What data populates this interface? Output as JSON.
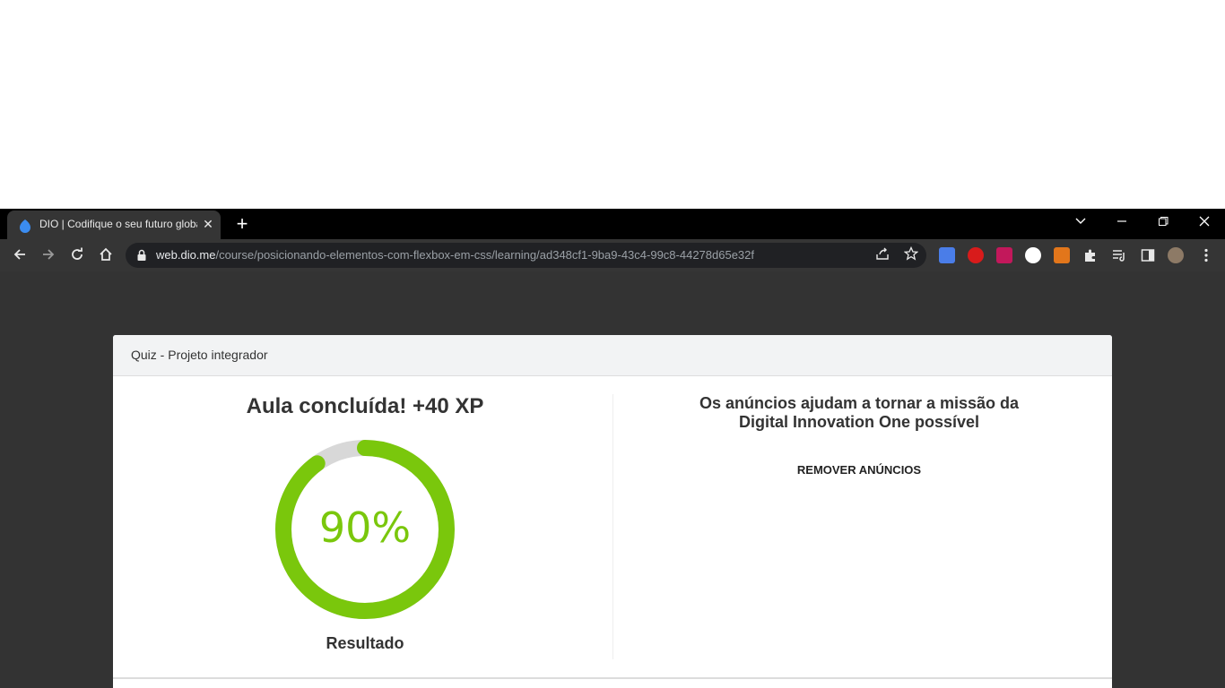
{
  "browser": {
    "tab_title": "DIO | Codifique o seu futuro global",
    "tab_close": "✕",
    "new_tab": "+",
    "url_host": "web.dio.me",
    "url_path": "/course/posicionando-elementos-com-flexbox-em-css/learning/ad348cf1-9ba9-43c4-99c8-44278d65e32f"
  },
  "card": {
    "header_title": "Quiz - Projeto integrador",
    "lesson_title": "Aula concluída! +40 XP",
    "result_percent": "90%",
    "progress_fraction": 0.9,
    "result_label": "Resultado",
    "ads_title_line1": "Os anúncios ajudam a tornar a missão da",
    "ads_title_line2": "Digital Innovation One possível",
    "remove_ads": "REMOVER ANÚNCIOS"
  },
  "colors": {
    "accent": "#7ac70c",
    "track": "#d8d8d8",
    "page_bg": "#333333",
    "chrome_bg": "#353535"
  }
}
